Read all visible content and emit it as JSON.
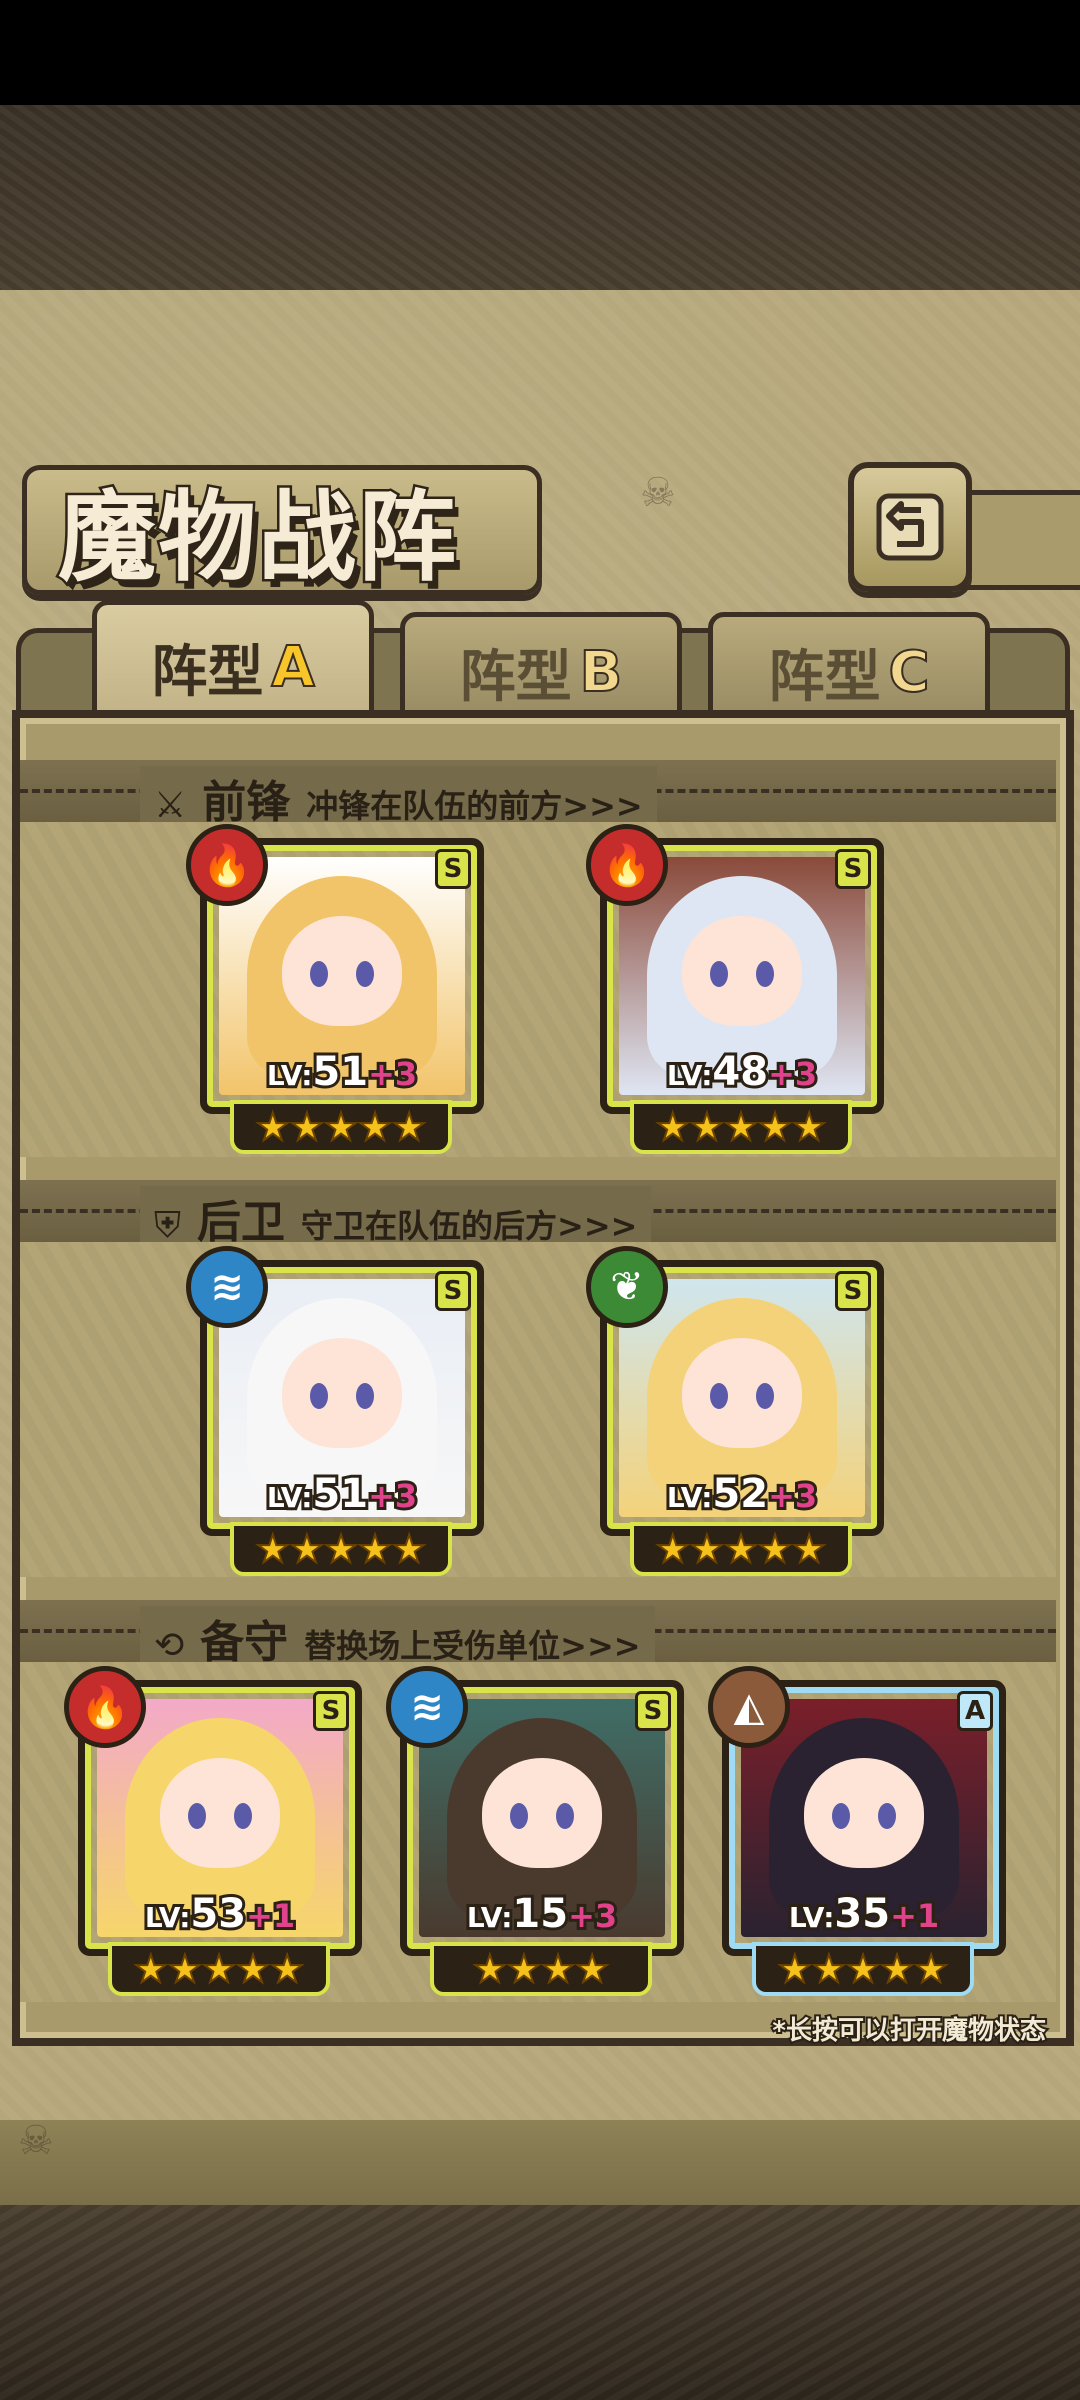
{
  "header": {
    "title": "魔物战阵",
    "back_icon": "return-arrow-icon"
  },
  "tabs": [
    {
      "label": "阵型",
      "letter": "A",
      "active": true
    },
    {
      "label": "阵型",
      "letter": "B",
      "active": false
    },
    {
      "label": "阵型",
      "letter": "C",
      "active": false
    }
  ],
  "sections": {
    "front": {
      "title": "前锋",
      "subtitle": "冲锋在队伍的前方>>>",
      "icon": "sword-icon"
    },
    "rear": {
      "title": "后卫",
      "subtitle": "守卫在队伍的后方>>>",
      "icon": "shield-icon"
    },
    "reserve": {
      "title": "备守",
      "subtitle": "替换场上受伤单位>>>",
      "icon": "swap-icon"
    }
  },
  "units": {
    "front": [
      {
        "element": "fire",
        "rank": "S",
        "lv_label": "LV:",
        "level": "51",
        "plus": "+3",
        "stars": 5
      },
      {
        "element": "fire",
        "rank": "S",
        "lv_label": "LV:",
        "level": "48",
        "plus": "+3",
        "stars": 5
      }
    ],
    "rear": [
      {
        "element": "water",
        "rank": "S",
        "lv_label": "LV:",
        "level": "51",
        "plus": "+3",
        "stars": 5
      },
      {
        "element": "wind",
        "rank": "S",
        "lv_label": "LV:",
        "level": "52",
        "plus": "+3",
        "stars": 5
      }
    ],
    "reserve": [
      {
        "element": "fire",
        "rank": "S",
        "lv_label": "LV:",
        "level": "53",
        "plus": "+1",
        "stars": 5
      },
      {
        "element": "water",
        "rank": "S",
        "lv_label": "LV:",
        "level": "15",
        "plus": "+3",
        "stars": 4
      },
      {
        "element": "earth",
        "rank": "A",
        "lv_label": "LV:",
        "level": "35",
        "plus": "+1",
        "stars": 5
      }
    ]
  },
  "hint": "*长按可以打开魔物状态",
  "colors": {
    "rank_s": "#d9e34a",
    "rank_a": "#9fdcf4",
    "plus": "#e0438c"
  }
}
